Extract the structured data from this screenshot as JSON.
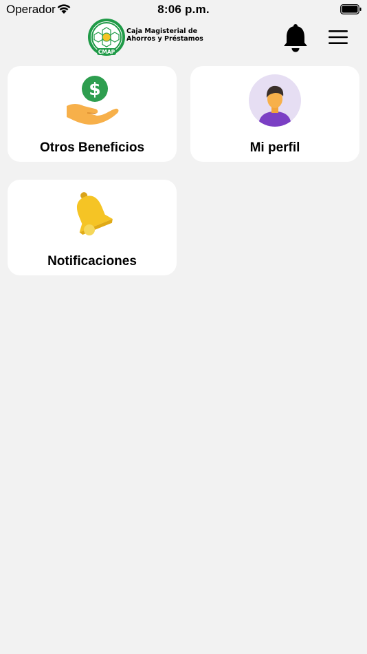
{
  "status_bar": {
    "carrier": "Operador",
    "time": "8:06 p.m."
  },
  "header": {
    "logo_line1": "Caja Magisterial de",
    "logo_line2": "Ahorros y Préstamos",
    "logo_badge": "CMAP",
    "notifications_icon": "bell-icon",
    "menu_icon": "hamburger-menu-icon"
  },
  "cards": [
    {
      "label": "Otros Beneficios",
      "icon": "money-hand-icon"
    },
    {
      "label": "Mi perfil",
      "icon": "user-avatar-icon"
    },
    {
      "label": "Notificaciones",
      "icon": "yellow-bell-icon"
    }
  ],
  "colors": {
    "background": "#f2f2f2",
    "card": "#ffffff",
    "brand_green": "#1f9a47",
    "coin_green": "#2e9e4f",
    "hand_orange": "#f7b04a",
    "bell_yellow": "#f5c425",
    "avatar_bg": "#e6def3",
    "avatar_shirt": "#7b3fc4"
  }
}
